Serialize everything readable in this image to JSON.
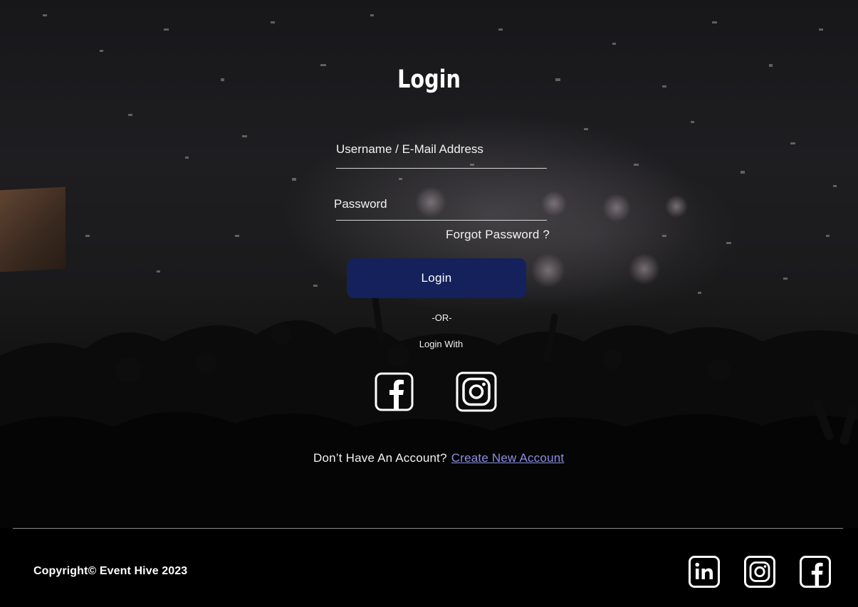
{
  "page": {
    "title": "Login"
  },
  "form": {
    "username_placeholder": "Username / E-Mail Address",
    "password_placeholder": "Password",
    "forgot_password": "Forgot Password ?",
    "login_button": "Login",
    "separator": "-OR-",
    "login_with": "Login With"
  },
  "social_login": [
    {
      "name": "facebook",
      "icon": "facebook-icon"
    },
    {
      "name": "instagram",
      "icon": "instagram-icon"
    }
  ],
  "signup": {
    "prompt": "Don’t Have An Account?",
    "link": "Create New Account",
    "link_color": "#8d8ee4"
  },
  "footer": {
    "copyright": "Copyright© Event Hive 2023",
    "social": [
      {
        "name": "linkedin",
        "icon": "linkedin-icon"
      },
      {
        "name": "instagram",
        "icon": "instagram-icon"
      },
      {
        "name": "facebook",
        "icon": "facebook-icon"
      }
    ]
  },
  "colors": {
    "button": "#14215a",
    "background": "#000000",
    "text": "#ffffff"
  }
}
